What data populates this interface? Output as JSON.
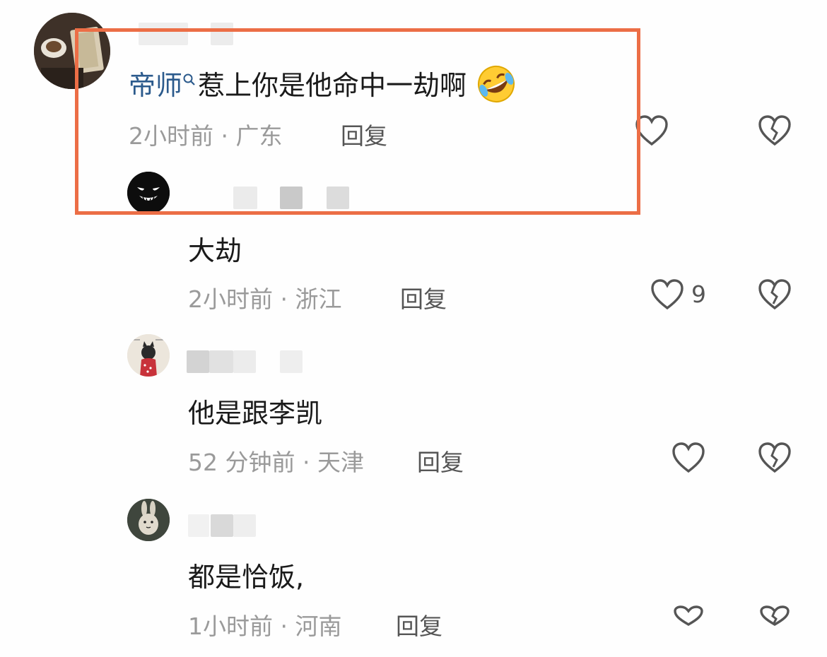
{
  "colors": {
    "highlight_border": "#ec6e46",
    "username_blue": "#2b5a8c",
    "meta_gray": "#9a9a9a",
    "icon_gray": "#555555"
  },
  "main_comment": {
    "username": "帝师",
    "text": "惹上你是他命中一劫啊",
    "emoji": "rolling-on-floor-laughing-emoji",
    "meta": "2小时前 · 广东",
    "reply_label": "回复"
  },
  "replies": [
    {
      "text": "大劫",
      "meta": "2小时前 · 浙江",
      "reply_label": "回复",
      "like_count": "9"
    },
    {
      "text": "他是跟李凯",
      "meta": "52 分钟前 · 天津",
      "reply_label": "回复"
    },
    {
      "text": "都是恰饭,",
      "meta": "1小时前 · 河南",
      "reply_label": "回复"
    }
  ]
}
